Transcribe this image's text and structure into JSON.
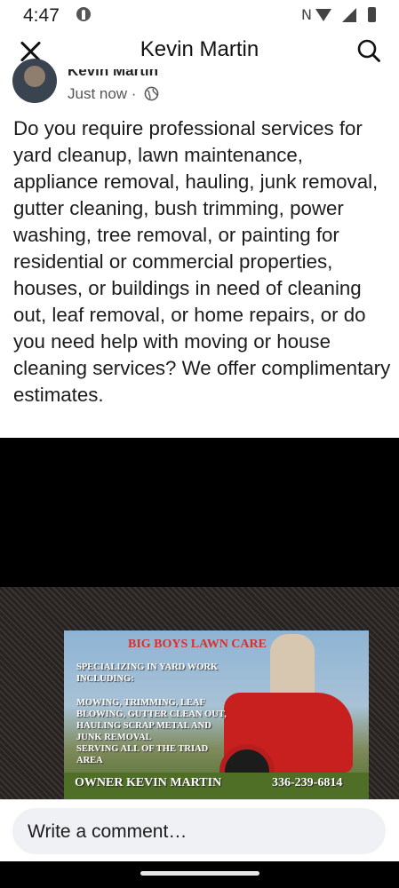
{
  "status_bar": {
    "time": "4:47",
    "icons": [
      "facebook-notification-icon",
      "nfc-icon",
      "wifi-icon",
      "signal-icon",
      "battery-icon"
    ]
  },
  "app_bar": {
    "title": "Kevin Martin",
    "close_icon": "close-icon",
    "search_icon": "search-icon"
  },
  "post": {
    "author_name": "Kevin Martin",
    "timestamp": "Just now ·",
    "privacy_icon": "globe-icon",
    "text": "Do you require professional services for yard cleanup, lawn maintenance, appliance removal, hauling, junk removal, gutter cleaning, bush trimming, power washing, tree removal, or painting for residential or commercial properties, houses, or buildings in need of cleaning out, leaf removal, or home repairs, or do you need help with moving or house cleaning services? We offer complimentary estimates.",
    "image": {
      "card_title": "BIG BOYS LAWN CARE",
      "card_lines": [
        "SPECIALIZING IN YARD WORK",
        "INCLUDING:",
        "MOWING, TRIMMING, LEAF",
        "BLOWING, GUTTER CLEAN OUT,",
        "HAULING SCRAP METAL AND",
        "JUNK REMOVAL",
        "SERVING ALL OF THE TRIAD",
        "AREA"
      ],
      "owner": "OWNER KEVIN MARTIN",
      "phone": "336-239-6814"
    }
  },
  "comment": {
    "placeholder": "Write a comment…"
  }
}
